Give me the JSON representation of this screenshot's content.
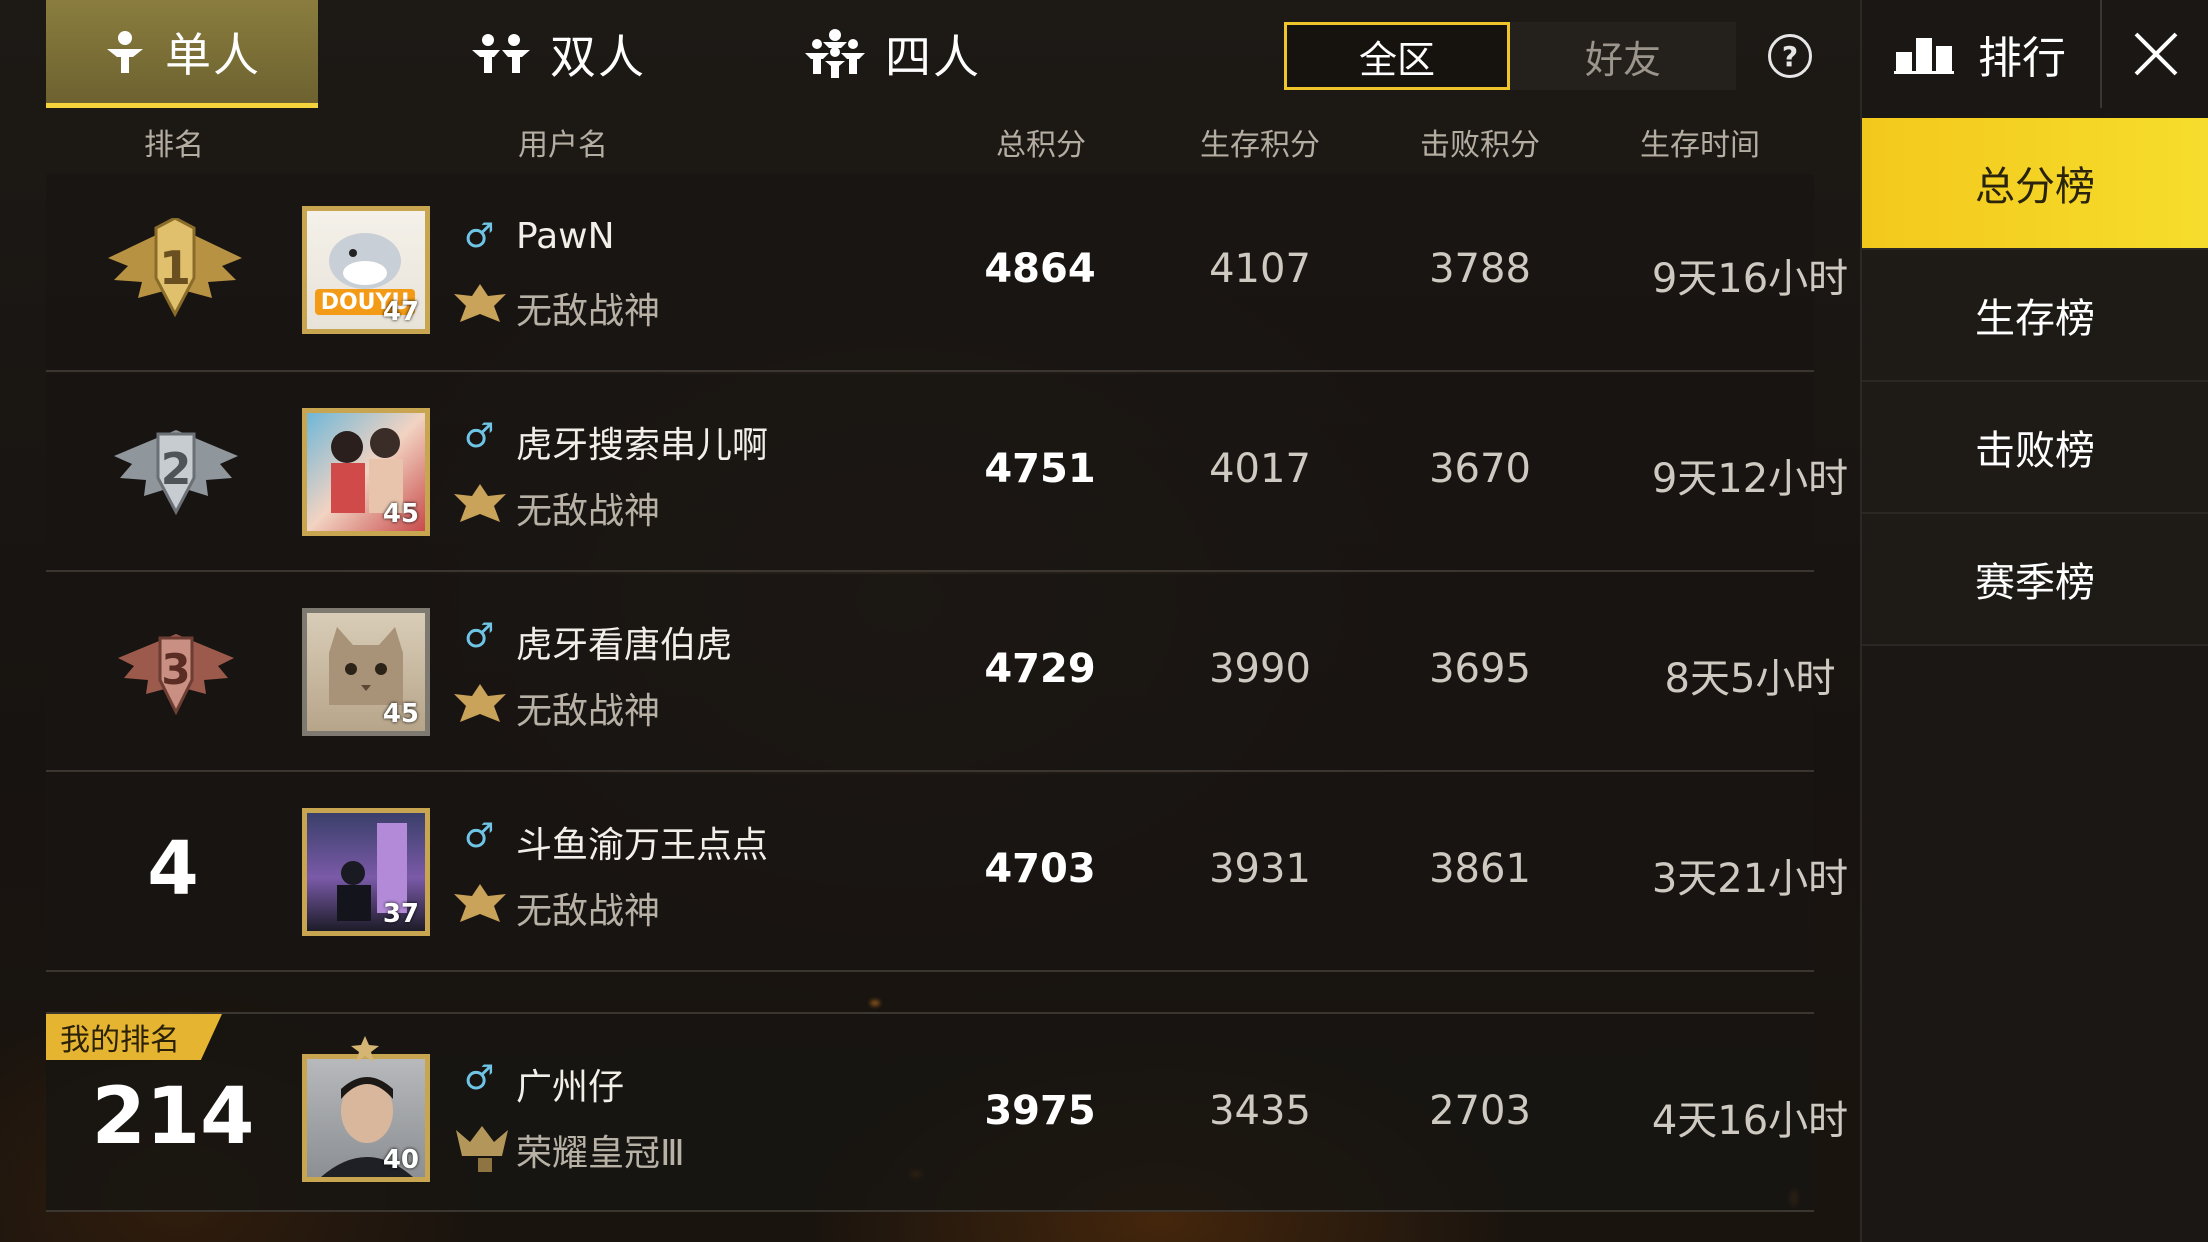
{
  "mode_tabs": [
    {
      "label": "单人",
      "active": true
    },
    {
      "label": "双人",
      "active": false
    },
    {
      "label": "四人",
      "active": false
    }
  ],
  "scope": {
    "all_label": "全区",
    "friends_label": "好友",
    "selected": "全区"
  },
  "help_label": "?",
  "columns": {
    "rank": "排名",
    "username": "用户名",
    "total": "总积分",
    "survival": "生存积分",
    "kill": "击败积分",
    "time": "生存时间"
  },
  "rows": [
    {
      "rank": "1",
      "level": "47",
      "name": "PawN",
      "tier": "无敌战神",
      "total": "4864",
      "survival": "4107",
      "kill": "3788",
      "time": "9天16小时"
    },
    {
      "rank": "2",
      "level": "45",
      "name": "虎牙搜索串儿啊",
      "tier": "无敌战神",
      "total": "4751",
      "survival": "4017",
      "kill": "3670",
      "time": "9天12小时"
    },
    {
      "rank": "3",
      "level": "45",
      "name": "虎牙看唐伯虎",
      "tier": "无敌战神",
      "total": "4729",
      "survival": "3990",
      "kill": "3695",
      "time": "8天5小时"
    },
    {
      "rank": "4",
      "level": "37",
      "name": "斗鱼渝万王点点",
      "tier": "无敌战神",
      "total": "4703",
      "survival": "3931",
      "kill": "3861",
      "time": "3天21小时"
    }
  ],
  "my_rank": {
    "tag": "我的排名",
    "rank": "214",
    "level": "40",
    "name": "广州仔",
    "tier": "荣耀皇冠Ⅲ",
    "total": "3975",
    "survival": "3435",
    "kill": "2703",
    "time": "4天16小时"
  },
  "avatar_badge_text": "DOUYU",
  "gender_symbol": "♂",
  "right_panel": {
    "title": "排行",
    "tabs": [
      {
        "label": "总分榜",
        "active": true
      },
      {
        "label": "生存榜",
        "active": false
      },
      {
        "label": "击败榜",
        "active": false
      },
      {
        "label": "赛季榜",
        "active": false
      }
    ]
  },
  "colors": {
    "accent": "#f3c81c",
    "gold": "#c8a551",
    "male": "#6fc5e6"
  }
}
